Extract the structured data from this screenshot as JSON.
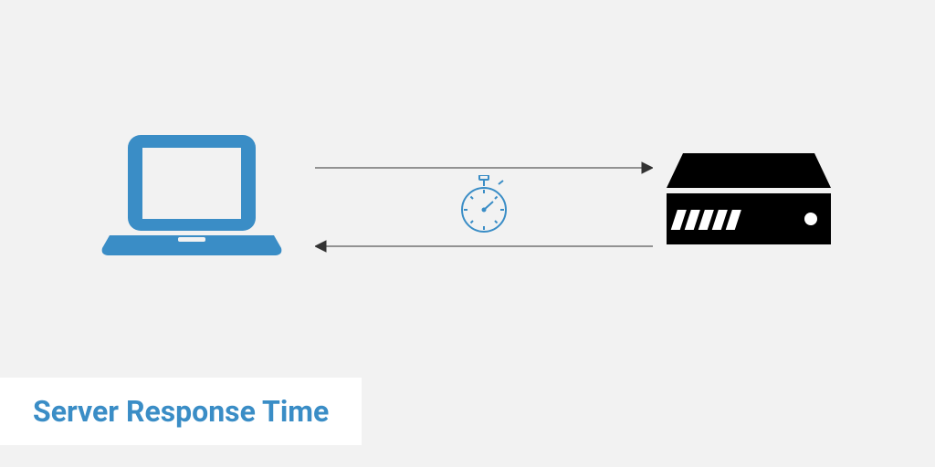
{
  "title": "Server Response Time",
  "colors": {
    "accent": "#3a8dc6",
    "background": "#f2f2f2",
    "dark": "#000000",
    "line": "#333333"
  },
  "icons": {
    "left": "laptop",
    "right": "server",
    "center": "stopwatch"
  }
}
